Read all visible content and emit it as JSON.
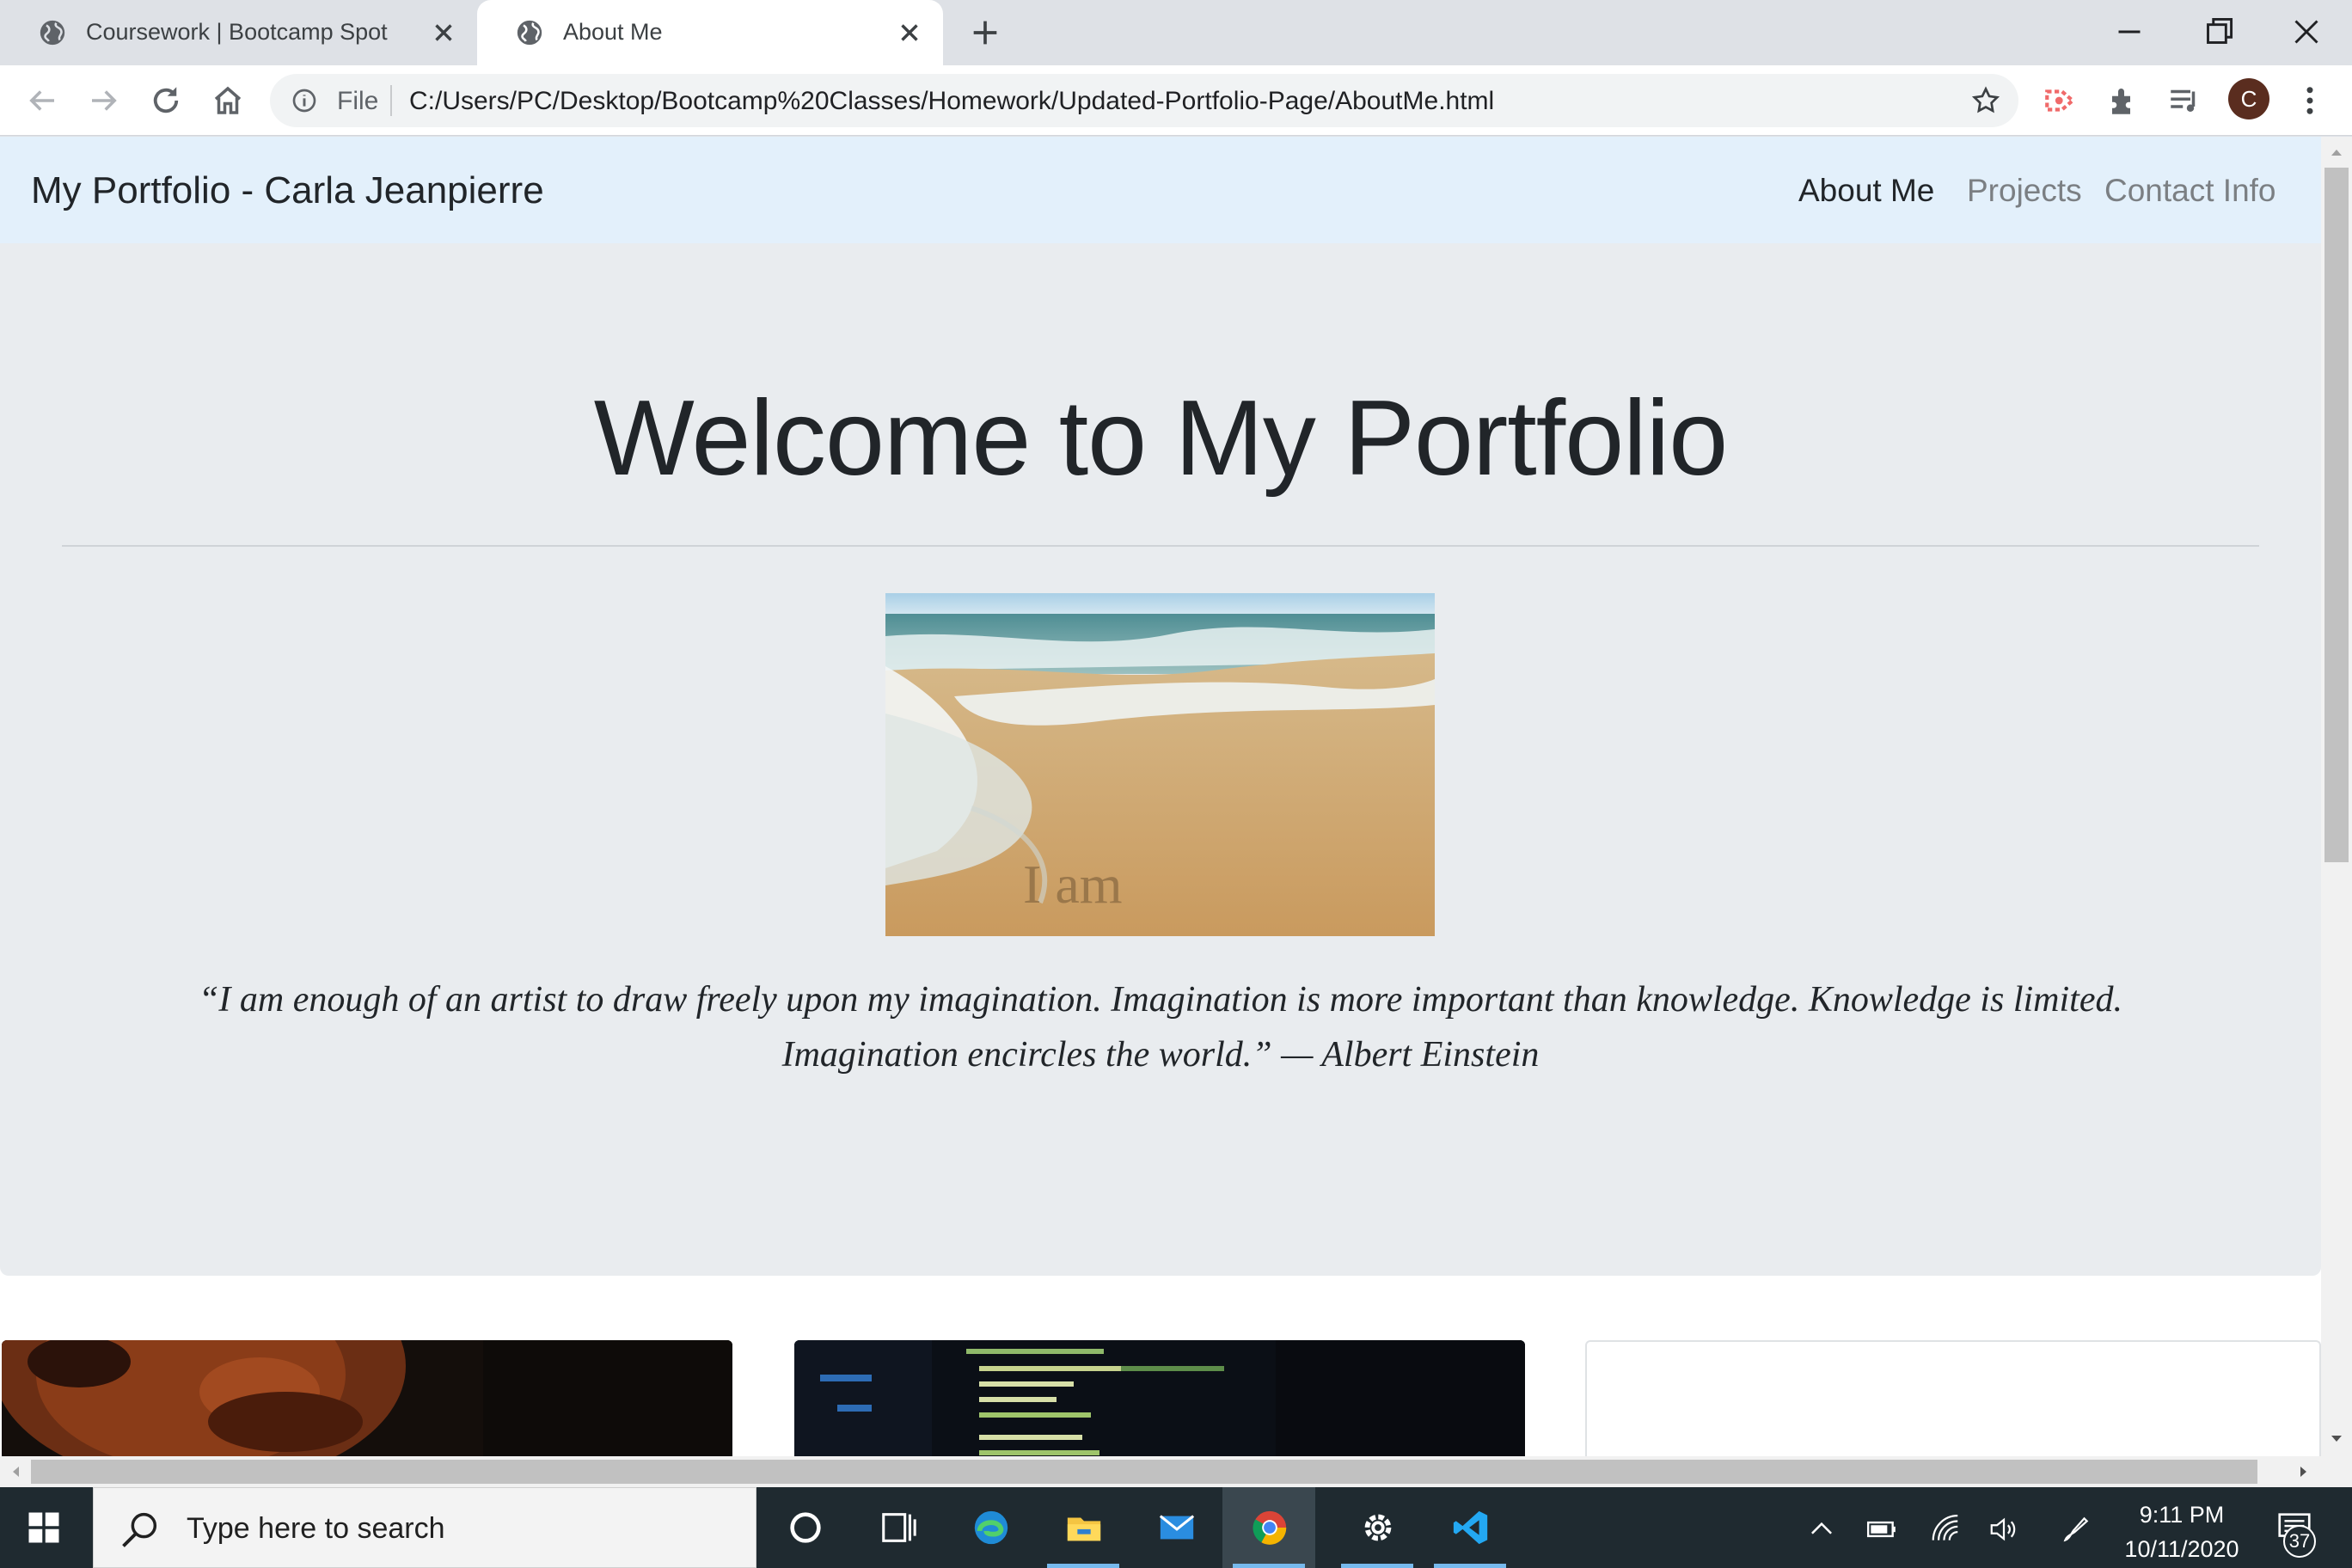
{
  "browser": {
    "tabs": [
      {
        "title": "Coursework | Bootcamp Spot",
        "icon": "globe-icon",
        "active": false
      },
      {
        "title": "About Me",
        "icon": "globe-icon",
        "active": true
      }
    ],
    "address": {
      "scheme_label": "File",
      "url": "C:/Users/PC/Desktop/Bootcamp%20Classes/Homework/Updated-Portfolio-Page/AboutMe.html"
    },
    "profile_initial": "C"
  },
  "page": {
    "navbar": {
      "brand": "My Portfolio - Carla Jeanpierre",
      "links": [
        {
          "label": "About Me",
          "active": true
        },
        {
          "label": "Projects",
          "active": false
        },
        {
          "label": "Contact Info",
          "active": false
        }
      ]
    },
    "jumbotron": {
      "heading": "Welcome to My Portfolio",
      "image_caption_text": "I am",
      "quote_line1": "“I am enough of an artist to draw freely upon my imagination. Imagination is more important than knowledge. Knowledge is limited.",
      "quote_line2": "Imagination encircles the world.” — Albert Einstein"
    }
  },
  "taskbar": {
    "search_placeholder": "Type here to search",
    "apps": [
      "cortana-icon",
      "task-view-icon",
      "edge-icon",
      "file-explorer-icon",
      "mail-icon",
      "chrome-icon",
      "settings-icon",
      "vscode-icon"
    ],
    "clock_time": "9:11 PM",
    "clock_date": "10/11/2020",
    "notification_count": "37"
  },
  "colors": {
    "navbar_bg": "#e3f0fb",
    "jumbotron_bg": "#e9ecef",
    "taskbar_bg": "#1f2a30",
    "chrome_tabstrip": "#dee1e6"
  }
}
